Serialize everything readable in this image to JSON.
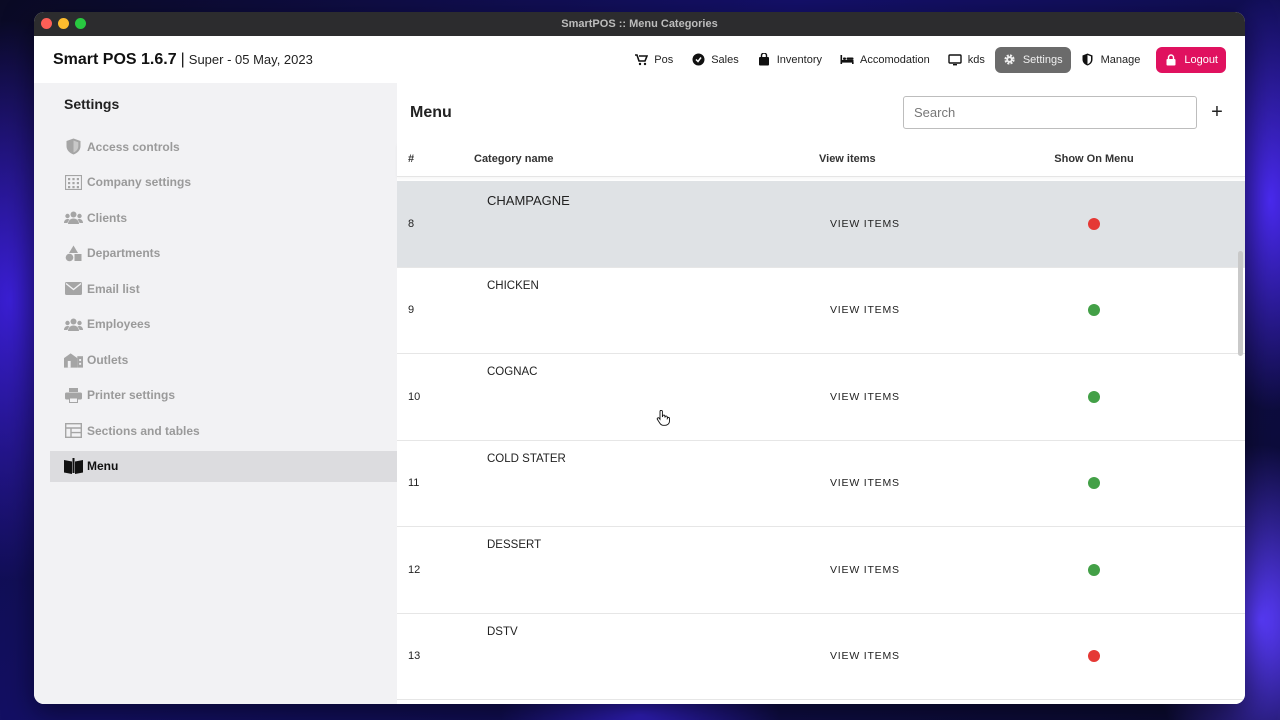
{
  "window": {
    "title": "SmartPOS :: Menu Categories"
  },
  "appbar": {
    "brand": "Smart POS 1.6.7",
    "separator": "|",
    "subtitle": "Super - 05 May, 2023",
    "nav": [
      {
        "label": "Pos",
        "icon": "cart-icon"
      },
      {
        "label": "Sales",
        "icon": "badge-icon"
      },
      {
        "label": "Inventory",
        "icon": "bag-icon"
      },
      {
        "label": "Accomodation",
        "icon": "bed-icon"
      },
      {
        "label": "kds",
        "icon": "monitor-icon"
      },
      {
        "label": "Settings",
        "icon": "gear-icon"
      },
      {
        "label": "Manage",
        "icon": "shield-icon"
      },
      {
        "label": "Logout",
        "icon": "lock-icon"
      }
    ],
    "active_nav": "Settings",
    "logout_color": "#e0115f"
  },
  "sidebar": {
    "title": "Settings",
    "items": [
      {
        "label": "Access controls",
        "icon": "shield-icon"
      },
      {
        "label": "Company settings",
        "icon": "building-icon"
      },
      {
        "label": "Clients",
        "icon": "people-icon"
      },
      {
        "label": "Departments",
        "icon": "shapes-icon"
      },
      {
        "label": "Email list",
        "icon": "envelope-icon"
      },
      {
        "label": "Employees",
        "icon": "people-icon"
      },
      {
        "label": "Outlets",
        "icon": "store-icon"
      },
      {
        "label": "Printer settings",
        "icon": "printer-icon"
      },
      {
        "label": "Sections and tables",
        "icon": "table-icon"
      },
      {
        "label": "Menu",
        "icon": "book-icon"
      }
    ],
    "active": "Menu"
  },
  "main": {
    "title": "Menu",
    "search": {
      "placeholder": "Search",
      "value": ""
    },
    "add_label": "+",
    "columns": [
      "#",
      "Category name",
      "View items",
      "Show On Menu"
    ],
    "rows": [
      {
        "num": "8",
        "name": "CHAMPAGNE",
        "view": "VIEW ITEMS",
        "show": false,
        "selected": true
      },
      {
        "num": "9",
        "name": "CHICKEN",
        "view": "VIEW ITEMS",
        "show": true
      },
      {
        "num": "10",
        "name": "COGNAC",
        "view": "VIEW ITEMS",
        "show": true
      },
      {
        "num": "11",
        "name": "COLD STATER",
        "view": "VIEW ITEMS",
        "show": true
      },
      {
        "num": "12",
        "name": "DESSERT",
        "view": "VIEW ITEMS",
        "show": true
      },
      {
        "num": "13",
        "name": "DSTV",
        "view": "VIEW ITEMS",
        "show": false
      }
    ],
    "status_colors": {
      "on": "#43a047",
      "off": "#e53935"
    }
  }
}
